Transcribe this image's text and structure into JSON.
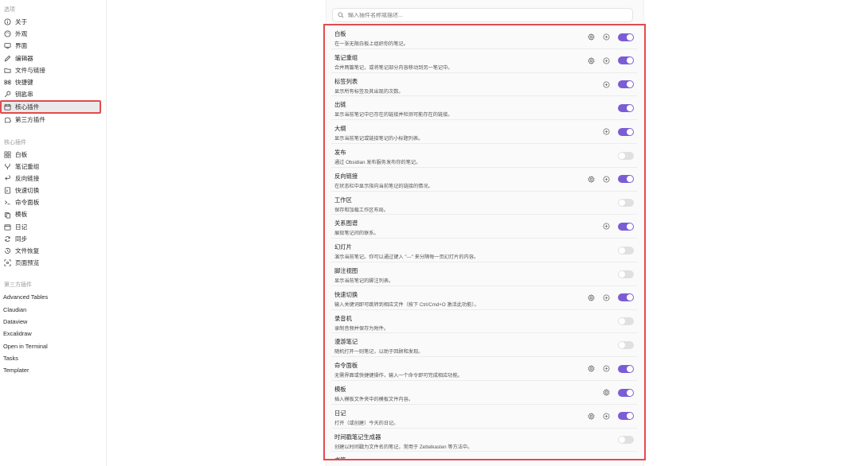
{
  "sidebar": {
    "options_title": "选项",
    "options": [
      {
        "label": "关于",
        "icon": "info-icon"
      },
      {
        "label": "外观",
        "icon": "palette-icon"
      },
      {
        "label": "界面",
        "icon": "monitor-icon"
      },
      {
        "label": "编辑器",
        "icon": "pen-icon"
      },
      {
        "label": "文件与链接",
        "icon": "folder-link-icon"
      },
      {
        "label": "快捷键",
        "icon": "command-icon"
      },
      {
        "label": "钥匙串",
        "icon": "key-icon"
      },
      {
        "label": "核心插件",
        "icon": "calendar-plugin-icon",
        "active": true
      },
      {
        "label": "第三方插件",
        "icon": "puzzle-icon"
      }
    ],
    "core_title": "核心插件",
    "core": [
      {
        "label": "白板",
        "icon": "grid-icon"
      },
      {
        "label": "笔记重组",
        "icon": "merge-icon"
      },
      {
        "label": "反向链接",
        "icon": "backlink-icon"
      },
      {
        "label": "快速切换",
        "icon": "switch-icon"
      },
      {
        "label": "命令面板",
        "icon": "terminal-icon"
      },
      {
        "label": "模板",
        "icon": "template-icon"
      },
      {
        "label": "日记",
        "icon": "calendar-icon"
      },
      {
        "label": "同步",
        "icon": "sync-icon"
      },
      {
        "label": "文件恢复",
        "icon": "history-icon"
      },
      {
        "label": "页面预览",
        "icon": "preview-icon"
      }
    ],
    "third_title": "第三方插件",
    "third": [
      "Advanced Tables",
      "Claudian",
      "Dataview",
      "Excalidraw",
      "Open in Terminal",
      "Tasks",
      "Templater"
    ]
  },
  "search": {
    "placeholder": "输入插件名称或描述..."
  },
  "plugins": [
    {
      "name": "白板",
      "desc": "在一张无限白板上组织你的笔记。",
      "gear": true,
      "plus": true,
      "on": true
    },
    {
      "name": "笔记重组",
      "desc": "合并两篇笔记，或将笔记部分内容移动到另一笔记中。",
      "gear": true,
      "plus": true,
      "on": true
    },
    {
      "name": "标签列表",
      "desc": "显示所有标签及其出现的次数。",
      "gear": false,
      "plus": true,
      "on": true
    },
    {
      "name": "出链",
      "desc": "显示当前笔记中已存在的链接并检测可能存在的链接。",
      "gear": false,
      "plus": false,
      "on": true
    },
    {
      "name": "大纲",
      "desc": "显示当前笔记或链接笔记的小标题列表。",
      "gear": false,
      "plus": true,
      "on": true
    },
    {
      "name": "发布",
      "desc": "通过 Obsidian 发布服务发布你的笔记。",
      "gear": false,
      "plus": false,
      "on": false
    },
    {
      "name": "反向链接",
      "desc": "在状态栏中显示指向当前笔记的链接的情况。",
      "gear": true,
      "plus": true,
      "on": true
    },
    {
      "name": "工作区",
      "desc": "保存和加载工作区布局。",
      "gear": false,
      "plus": false,
      "on": false
    },
    {
      "name": "关系图谱",
      "desc": "展现笔记间的联系。",
      "gear": false,
      "plus": true,
      "on": true
    },
    {
      "name": "幻灯片",
      "desc": "演示当前笔记。你可以通过键入 \"---\" 来分隔每一页幻灯片的内容。",
      "gear": false,
      "plus": false,
      "on": false
    },
    {
      "name": "脚注视图",
      "desc": "显示当前笔记的脚注列表。",
      "gear": false,
      "plus": false,
      "on": false
    },
    {
      "name": "快速切换",
      "desc": "输入关键词即可跳转到相应文件（按下 Ctrl/Cmd+O 激活此功能）。",
      "gear": true,
      "plus": true,
      "on": true
    },
    {
      "name": "录音机",
      "desc": "录制音频并保存为附件。",
      "gear": false,
      "plus": false,
      "on": false
    },
    {
      "name": "漫游笔记",
      "desc": "随机打开一则笔记，以助于回顾和发现。",
      "gear": false,
      "plus": false,
      "on": false
    },
    {
      "name": "命令面板",
      "desc": "无需界面或快捷键操作，输入一个命令即可完成相应功能。",
      "gear": true,
      "plus": true,
      "on": true
    },
    {
      "name": "模板",
      "desc": "插入模板文件夹中的模板文件内容。",
      "gear": true,
      "plus": false,
      "on": true
    },
    {
      "name": "日记",
      "desc": "打开（或创建）今天的日记。",
      "gear": true,
      "plus": true,
      "on": true
    },
    {
      "name": "时间戳笔记生成器",
      "desc": "创建以时间戳为文件名的笔记，常用于 Zettelkasten 等方法中。",
      "gear": false,
      "plus": false,
      "on": false
    },
    {
      "name": "书签",
      "desc": "",
      "gear": false,
      "plus": true,
      "on": true
    }
  ],
  "colors": {
    "accent": "#7c5cd6",
    "highlight": "#e34b4f"
  }
}
